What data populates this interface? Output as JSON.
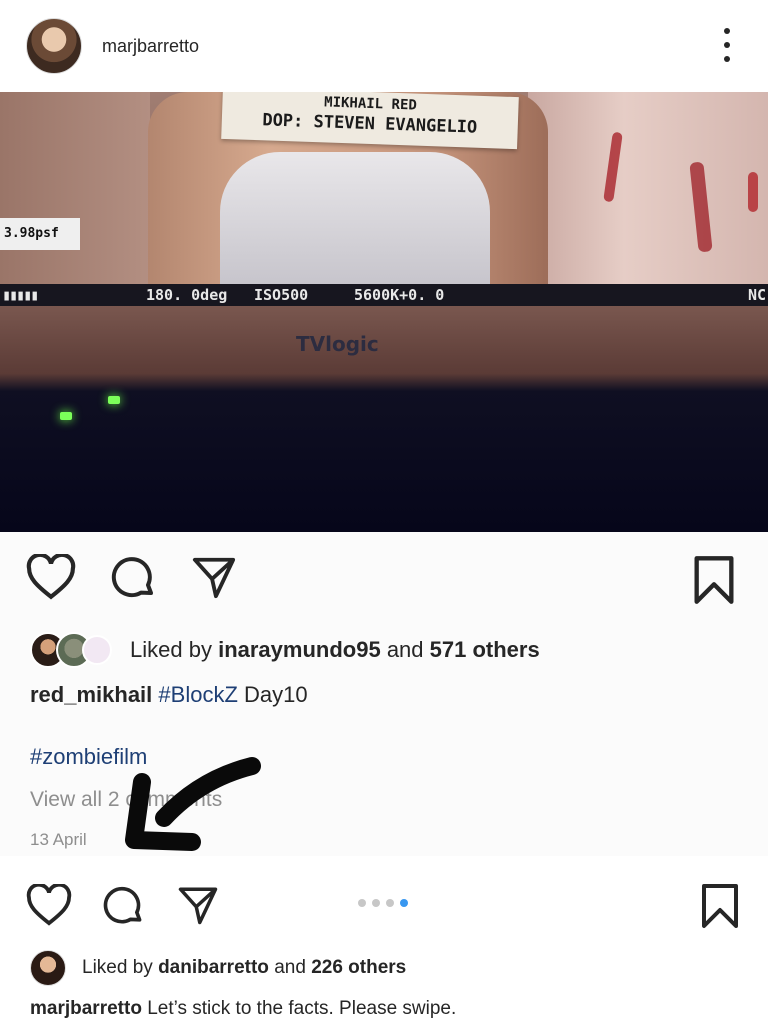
{
  "post": {
    "username": "marjbarretto",
    "more_icon": "more-vertical-icon"
  },
  "embedded_post": {
    "photo": {
      "slate_line1": "MIKHAIL RED",
      "slate_line2": "DOP: STEVEN EVANGELIO",
      "readout": "3.98psf",
      "shutter": "180. 0deg",
      "iso": "ISO500",
      "white_balance": "5600K+0. 0",
      "nd_label": "NC",
      "monitor_brand": "TVlogic"
    },
    "liked_by_prefix": "Liked by",
    "liked_by_user": "inaraymundo95",
    "liked_by_and": "and",
    "liked_by_others": "571 others",
    "caption_user": "red_mikhail",
    "caption_tag": "#BlockZ",
    "caption_text": "Day10",
    "hashtag": "#zombiefilm",
    "view_all": "View all 2 comments",
    "date": "13 April"
  },
  "outer_post": {
    "carousel": {
      "count": 4,
      "active_index": 3
    },
    "liked_by_prefix": "Liked by",
    "liked_by_user": "danibarretto",
    "liked_by_and": "and",
    "liked_by_others": "226 others",
    "caption_user": "marjbarretto",
    "caption_text": "Let’s stick to the facts. Please swipe."
  },
  "colors": {
    "text": "#262626",
    "hashtag": "#1e3f75",
    "muted": "#8e8e8e",
    "carousel_active": "#3897f0"
  }
}
